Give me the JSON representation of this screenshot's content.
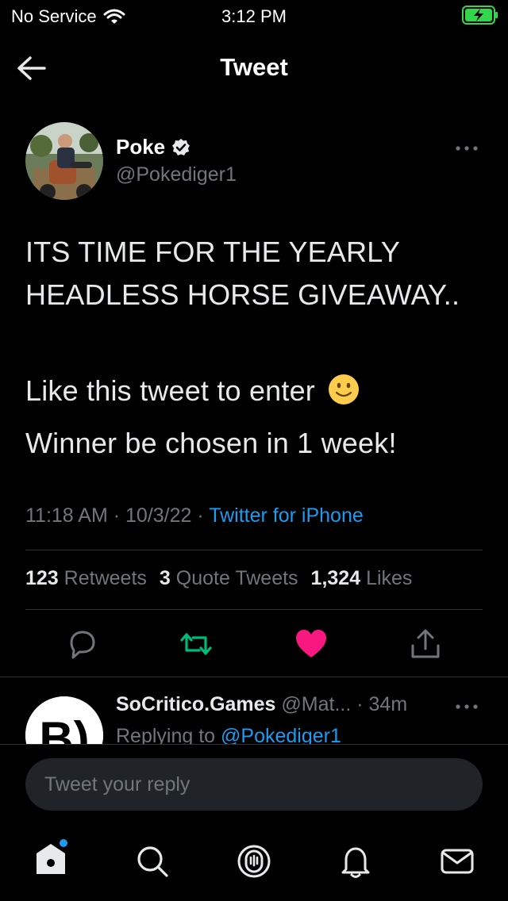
{
  "status_bar": {
    "carrier": "No Service",
    "time": "3:12 PM",
    "battery_state": "charging",
    "icons": [
      "wifi-icon",
      "battery-charging-icon"
    ]
  },
  "nav": {
    "title": "Tweet",
    "back_icon": "arrow-left-icon"
  },
  "tweet": {
    "author_name": "Poke",
    "author_handle": "@Pokediger1",
    "verified": true,
    "line1": "ITS TIME FOR THE YEARLY HEADLESS HORSE GIVEAWAY..",
    "line2": "Like this tweet to enter",
    "line3": "Winner be chosen in 1 week!",
    "time": "11:18 AM",
    "date": "10/3/22",
    "source": "Twitter for iPhone",
    "retweets_count": "123",
    "retweets_label": "Retweets",
    "quotes_count": "3",
    "quotes_label": "Quote Tweets",
    "likes_count": "1,324",
    "likes_label": "Likes",
    "liked": true
  },
  "actions": [
    "reply-icon",
    "retweet-icon",
    "like-icon",
    "share-icon"
  ],
  "colors": {
    "accent": "#1d9bf0",
    "retweet": "#00ba7c",
    "like": "#f91880",
    "background": "#000000",
    "muted": "#71767b"
  },
  "reply_preview": {
    "name": "SoCritico.Games",
    "handle": "@Mat...",
    "age": "34m",
    "replying_prefix": "Replying to",
    "replying_to": "@Pokediger1"
  },
  "compose": {
    "placeholder": "Tweet your reply"
  },
  "tabbar": [
    "home-icon",
    "search-icon",
    "spaces-icon",
    "notifications-icon",
    "messages-icon"
  ]
}
